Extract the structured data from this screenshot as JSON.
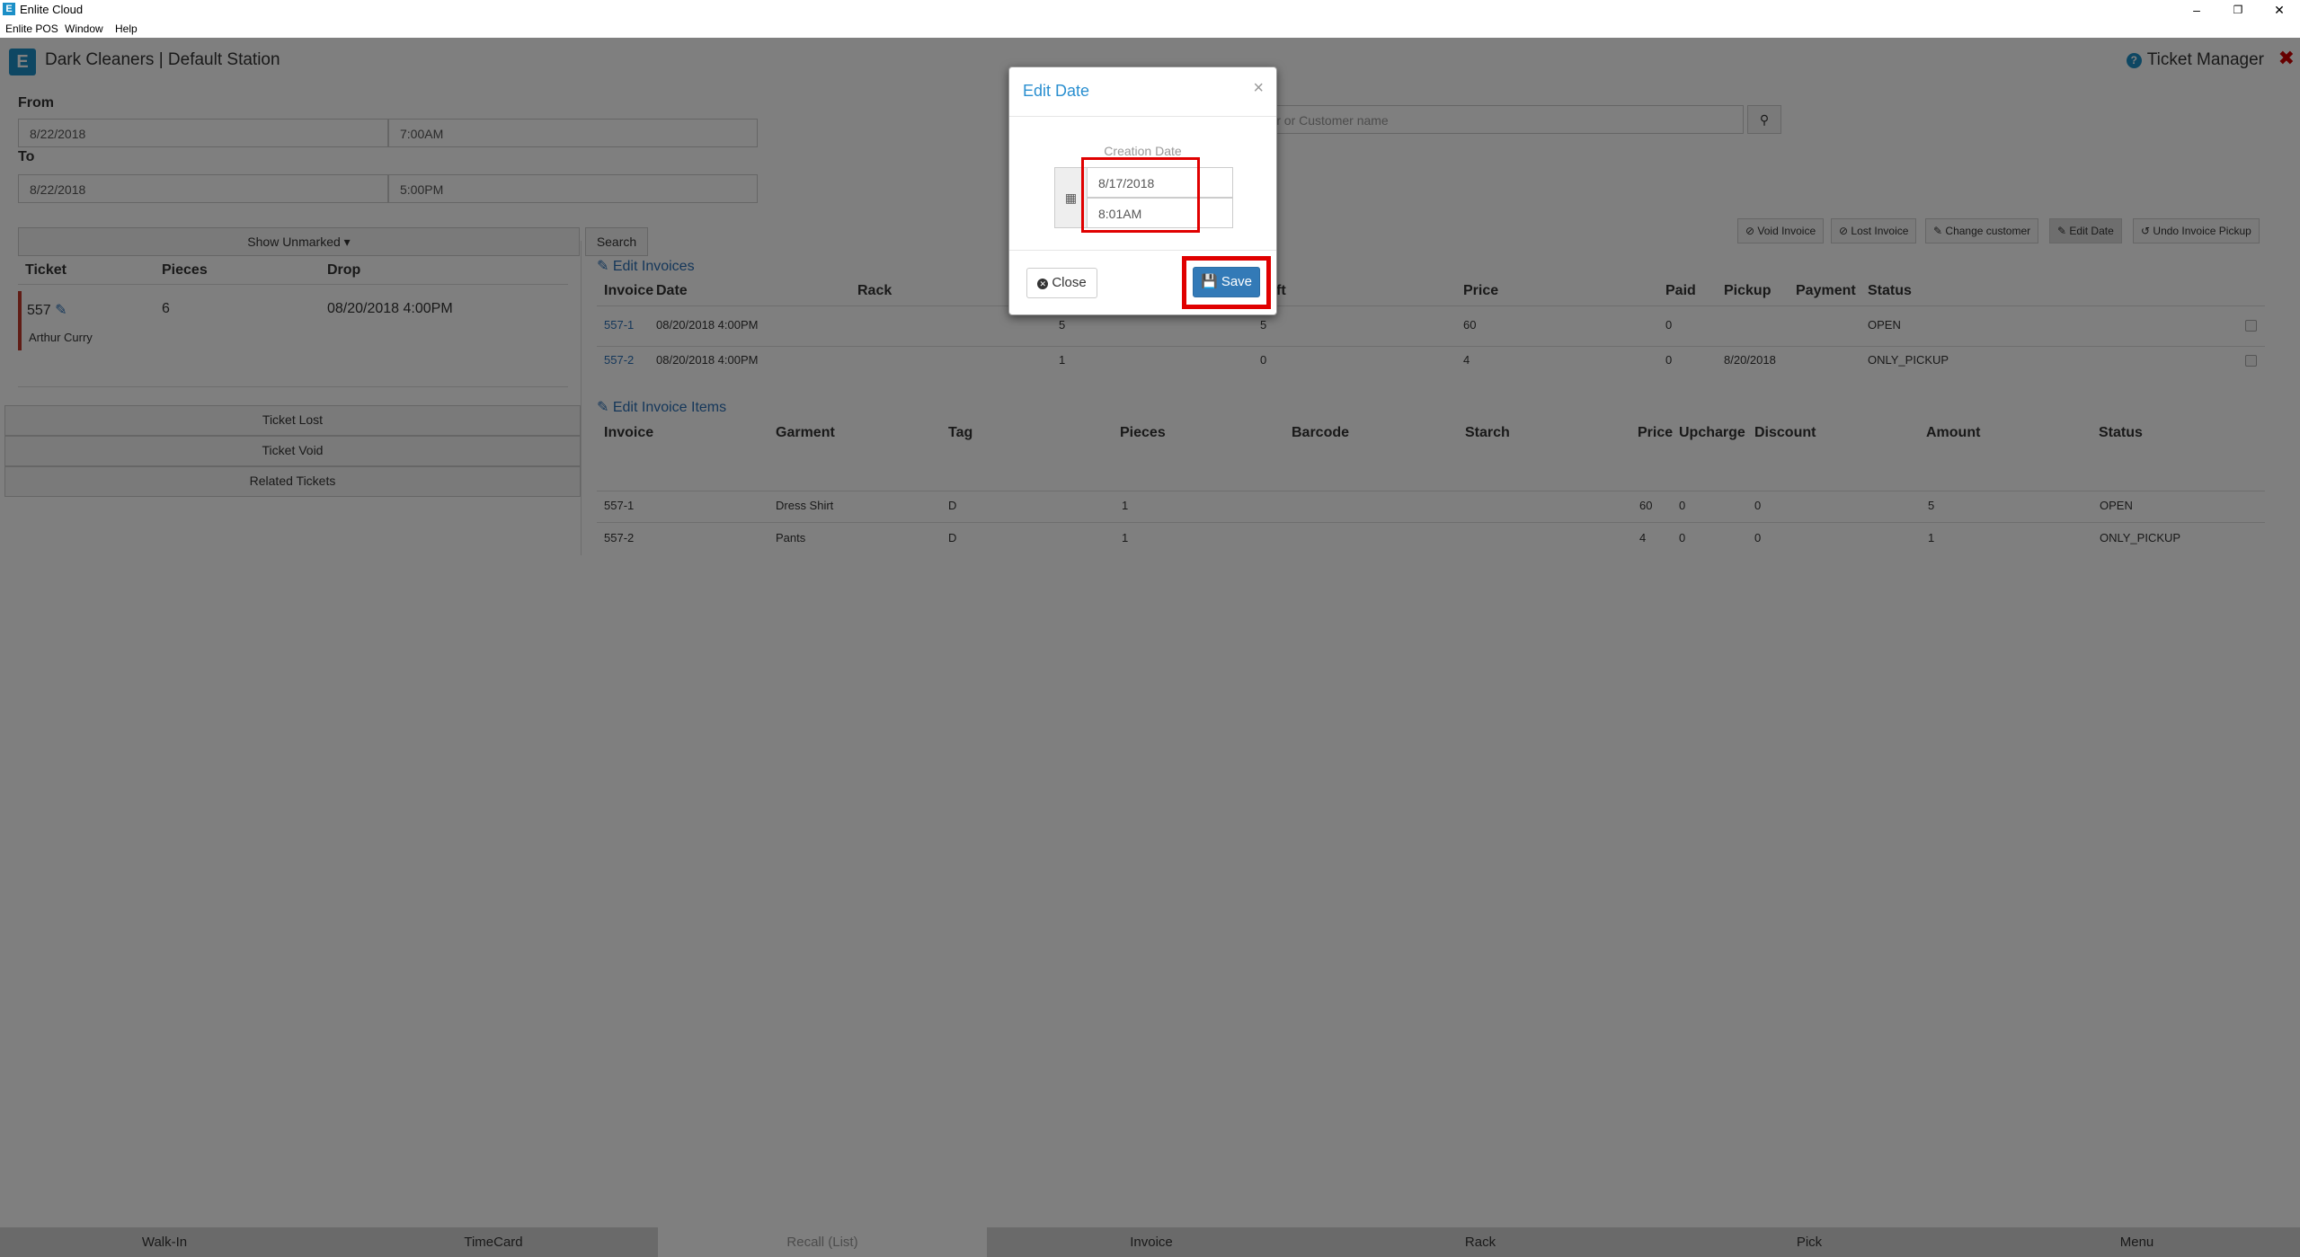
{
  "window": {
    "title": "Enlite Cloud",
    "menu": [
      "Enlite POS",
      "Window",
      "Help"
    ]
  },
  "header": {
    "title": "Dark Cleaners | Default Station",
    "right_title": "Ticket Manager"
  },
  "filters": {
    "from_label": "From",
    "from_date": "8/22/2018",
    "from_time": "7:00AM",
    "to_label": "To",
    "to_date": "8/22/2018",
    "to_time": "5:00PM",
    "search_placeholder": "mber or Customer name",
    "show_unmarked": "Show Unmarked",
    "search_button": "Search"
  },
  "tickets": {
    "headers": [
      "Ticket",
      "Pieces",
      "Drop"
    ],
    "rows": [
      {
        "ticket": "557",
        "pieces": "6",
        "drop": "08/20/2018 4:00PM",
        "customer": "Arthur Curry"
      }
    ]
  },
  "left_actions": [
    "Ticket Lost",
    "Ticket Void",
    "Related Tickets"
  ],
  "toolbar": [
    "Void Invoice",
    "Lost Invoice",
    "Change customer",
    "Edit Date",
    "Undo Invoice Pickup"
  ],
  "invoices": {
    "title": "Edit Invoices",
    "headers": [
      "Invoice",
      "Date",
      "Rack",
      "",
      "ft",
      "Price",
      "Paid",
      "Pickup",
      "Payment",
      "Status"
    ],
    "rows": [
      [
        "557-1",
        "08/20/2018 4:00PM",
        "",
        "5",
        "5",
        "60",
        "0",
        "",
        "",
        "OPEN"
      ],
      [
        "557-2",
        "08/20/2018 4:00PM",
        "",
        "1",
        "0",
        "4",
        "0",
        "8/20/2018",
        "",
        "ONLY_PICKUP"
      ]
    ]
  },
  "items": {
    "title": "Edit Invoice Items",
    "headers": [
      "Invoice",
      "Garment",
      "Tag",
      "Pieces",
      "Barcode",
      "Starch",
      "Price",
      "Upcharge",
      "Discount",
      "Amount",
      "Status"
    ],
    "rows": [
      [
        "557-1",
        "Dress Shirt",
        "D",
        "1",
        "",
        "",
        "60",
        "0",
        "0",
        "5",
        "OPEN"
      ],
      [
        "557-2",
        "Pants",
        "D",
        "1",
        "",
        "",
        "4",
        "0",
        "0",
        "1",
        "ONLY_PICKUP"
      ]
    ]
  },
  "footer_tabs": [
    "Walk-In",
    "TimeCard",
    "Recall (List)",
    "Invoice",
    "Rack",
    "Pick",
    "Menu"
  ],
  "modal": {
    "title": "Edit Date",
    "close_x": "×",
    "field_label": "Creation Date",
    "date_value": "8/17/2018",
    "time_value": "8:01AM",
    "close_label": "Close",
    "save_label": "Save"
  },
  "colors": {
    "accent": "#2a8fd0",
    "primary_button": "#337ab7",
    "highlight": "#e00000"
  }
}
